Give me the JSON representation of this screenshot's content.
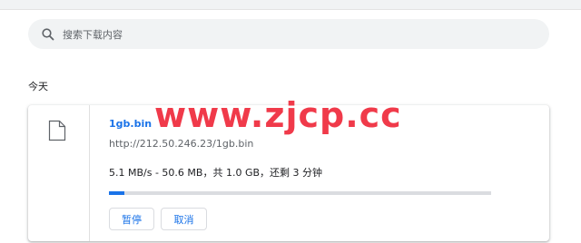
{
  "search": {
    "placeholder": "搜索下载内容",
    "icon": "search-icon"
  },
  "section": {
    "title": "今天"
  },
  "download": {
    "file_icon": "file-icon",
    "filename": "1gb.bin",
    "url": "http://212.50.246.23/1gb.bin",
    "status": "5.1 MB/s - 50.6 MB，共 1.0 GB，还剩 3 分钟",
    "progress_fraction": 0.04,
    "pause_label": "暂停",
    "cancel_label": "取消"
  },
  "watermark": {
    "text": "www.zjcp.cc"
  },
  "colors": {
    "accent": "#1a73e8",
    "watermark": "#f03a4a",
    "progress_track": "#dadce0"
  }
}
